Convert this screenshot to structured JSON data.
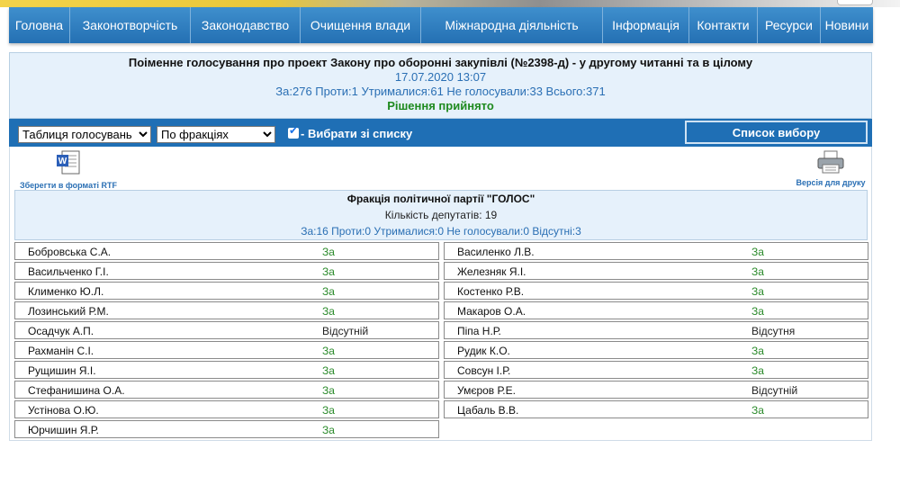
{
  "nav": [
    "Головна",
    "Законотворчість",
    "Законодавство",
    "Очищення влади",
    "Міжнародна діяльність",
    "Інформація",
    "Контакти",
    "Ресурси",
    "Новини"
  ],
  "header": {
    "title": "Поіменне голосування про проект Закону про оборонні закупівлі (№2398-д) - у другому читанні та в цілому",
    "datetime": "17.07.2020 13:07",
    "totals": "За:276 Проти:1 Утрималися:61 Не голосували:33 Всього:371",
    "decision": "Рішення прийнято"
  },
  "controls": {
    "select_view": "Таблиця голосувань",
    "select_group": "По фракціях",
    "checkbox_label": "- Вибрати зі списку",
    "list_button": "Список вибору"
  },
  "links": {
    "rtf": "Зберегти в форматі RTF",
    "print": "Версія для друку"
  },
  "faction": {
    "name": "Фракція політичної партії \"ГОЛОС\"",
    "count": "Кількість депутатів: 19",
    "summary": "За:16 Проти:0 Утрималися:0 Не голосували:0 Відсутні:3"
  },
  "deputies": [
    {
      "name": "Бобровська С.А.",
      "vote": "За"
    },
    {
      "name": "Василенко Л.В.",
      "vote": "За"
    },
    {
      "name": "Васильченко Г.І.",
      "vote": "За"
    },
    {
      "name": "Железняк Я.І.",
      "vote": "За"
    },
    {
      "name": "Клименко Ю.Л.",
      "vote": "За"
    },
    {
      "name": "Костенко Р.В.",
      "vote": "За"
    },
    {
      "name": "Лозинський Р.М.",
      "vote": "За"
    },
    {
      "name": "Макаров О.А.",
      "vote": "За"
    },
    {
      "name": "Осадчук А.П.",
      "vote": "Відсутній"
    },
    {
      "name": "Піпа Н.Р.",
      "vote": "Відсутня"
    },
    {
      "name": "Рахманін С.І.",
      "vote": "За"
    },
    {
      "name": "Рудик К.О.",
      "vote": "За"
    },
    {
      "name": "Рущишин Я.І.",
      "vote": "За"
    },
    {
      "name": "Совсун І.Р.",
      "vote": "За"
    },
    {
      "name": "Стефанишина О.А.",
      "vote": "За"
    },
    {
      "name": "Умєров Р.Е.",
      "vote": "Відсутній"
    },
    {
      "name": "Устінова О.Ю.",
      "vote": "За"
    },
    {
      "name": "Цабаль В.В.",
      "vote": "За"
    },
    {
      "name": "Юрчишин Я.Р.",
      "vote": "За"
    }
  ]
}
